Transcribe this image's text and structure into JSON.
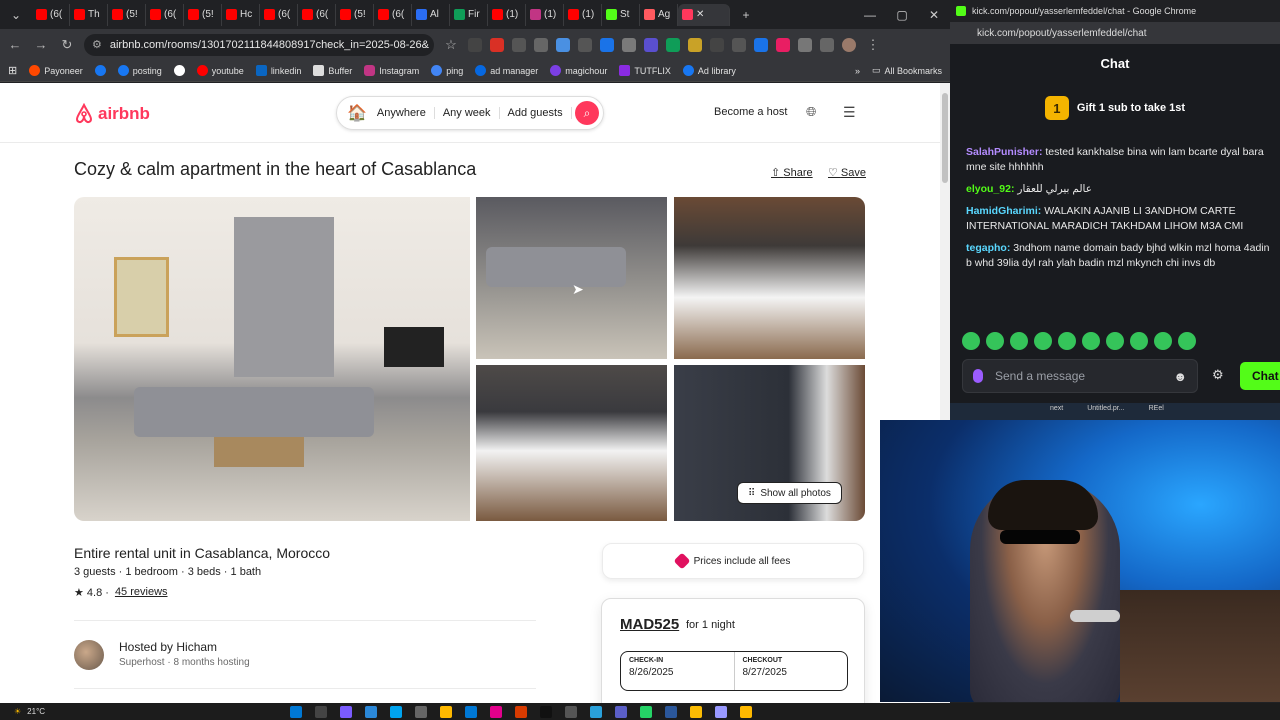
{
  "browser": {
    "tabs": [
      {
        "label": "(6(",
        "color": "#ff0000"
      },
      {
        "label": "Th",
        "color": "#ff0000"
      },
      {
        "label": "(5!",
        "color": "#ff0000"
      },
      {
        "label": "(6(",
        "color": "#ff0000"
      },
      {
        "label": "(5!",
        "color": "#ff0000"
      },
      {
        "label": "Hc",
        "color": "#ff0000"
      },
      {
        "label": "(6(",
        "color": "#ff0000"
      },
      {
        "label": "(6(",
        "color": "#ff0000"
      },
      {
        "label": "(5!",
        "color": "#ff0000"
      },
      {
        "label": "(6(",
        "color": "#ff0000"
      },
      {
        "label": "Al",
        "color": "#2a6df4"
      },
      {
        "label": "Fir",
        "color": "#0f9d58"
      },
      {
        "label": "(1)",
        "color": "#ff0000"
      },
      {
        "label": "(1)",
        "color": "#c13584"
      },
      {
        "label": "(1)",
        "color": "#ff0000"
      },
      {
        "label": "St",
        "color": "#53fc18"
      },
      {
        "label": "Ag",
        "color": "#ff5a5f"
      },
      {
        "label": "",
        "color": "#ff385c"
      }
    ],
    "address": "airbnb.com/rooms/1301702111844808917check_in=2025-08-26&",
    "bookmarks": [
      {
        "label": "Payoneer",
        "color": "#ff4800"
      },
      {
        "label": "",
        "color": "#1877f2"
      },
      {
        "label": "posting",
        "color": "#1877f2"
      },
      {
        "label": "",
        "color": "#4285f4"
      },
      {
        "label": "youtube",
        "color": "#ff0000"
      },
      {
        "label": "linkedin",
        "color": "#0a66c2"
      },
      {
        "label": "Buffer",
        "color": "#ffffff"
      },
      {
        "label": "Instagram",
        "color": "#c13584"
      },
      {
        "label": "ping",
        "color": "#4285f4"
      },
      {
        "label": "ad manager",
        "color": "#0668e1"
      },
      {
        "label": "magichour",
        "color": "#7b3fe4"
      },
      {
        "label": "TUTFLIX",
        "color": "#8a2be2"
      },
      {
        "label": "Ad library",
        "color": "#1877f2"
      }
    ],
    "all_bookmarks": "All Bookmarks"
  },
  "airbnb": {
    "logo": "airbnb",
    "search": {
      "anywhere": "Anywhere",
      "any_week": "Any week",
      "add_guests": "Add guests"
    },
    "become_host": "Become a host",
    "title": "Cozy & calm apartment in the heart of Casablanca",
    "share": "Share",
    "save": "Save",
    "show_all_photos": "Show all photos",
    "subtitle": "Entire rental unit in Casablanca, Morocco",
    "details": "3 guests · 1 bedroom · 3 beds · 1 bath",
    "rating": "★ 4.8 ·",
    "reviews": "45 reviews",
    "host_name": "Hosted by Hicham",
    "host_meta": "Superhost · 8 months hosting",
    "fees_notice": "Prices include all fees",
    "price": "MAD525",
    "price_unit": "for 1 night",
    "checkin_label": "CHECK-IN",
    "checkin_value": "8/26/2025",
    "checkout_label": "CHECKOUT",
    "checkout_value": "8/27/2025"
  },
  "chat": {
    "window_title": "kick.com/popout/yasserlemfeddel/chat - Google Chrome",
    "url": "kick.com/popout/yasserlemfeddel/chat",
    "header": "Chat",
    "gift_badge": "1",
    "gift_text": "Gift 1 sub to take 1st",
    "messages": [
      {
        "user": "SalahPunisher:",
        "user_color": "#b48cff",
        "text": "tested kankhalse bina win lam bcarte dyal bara mne site hhhhhh"
      },
      {
        "user": "elyou_92:",
        "user_color": "#53fc18",
        "text": "عالم بيرلي للعقار"
      },
      {
        "user": "HamidGharimi:",
        "user_color": "#5ad8ff",
        "text": "WALAKIN AJANIB LI 3ANDHOM CARTE INTERNATIONAL MARADICH TAKHDAM LIHOM M3A CMI"
      },
      {
        "user": "tegapho:",
        "user_color": "#5ad8ff",
        "text": "3ndhom name domain bady bjhd wlkin mzl homa 4adin b whd 39lia dyl rah ylah badin mzl mkynch chi invs db"
      }
    ],
    "input_placeholder": "Send a message",
    "send": "Chat"
  },
  "desktop_strip": [
    "next",
    "Untitled.pr...",
    "REel"
  ],
  "taskbar": {
    "weather": "21°C"
  }
}
